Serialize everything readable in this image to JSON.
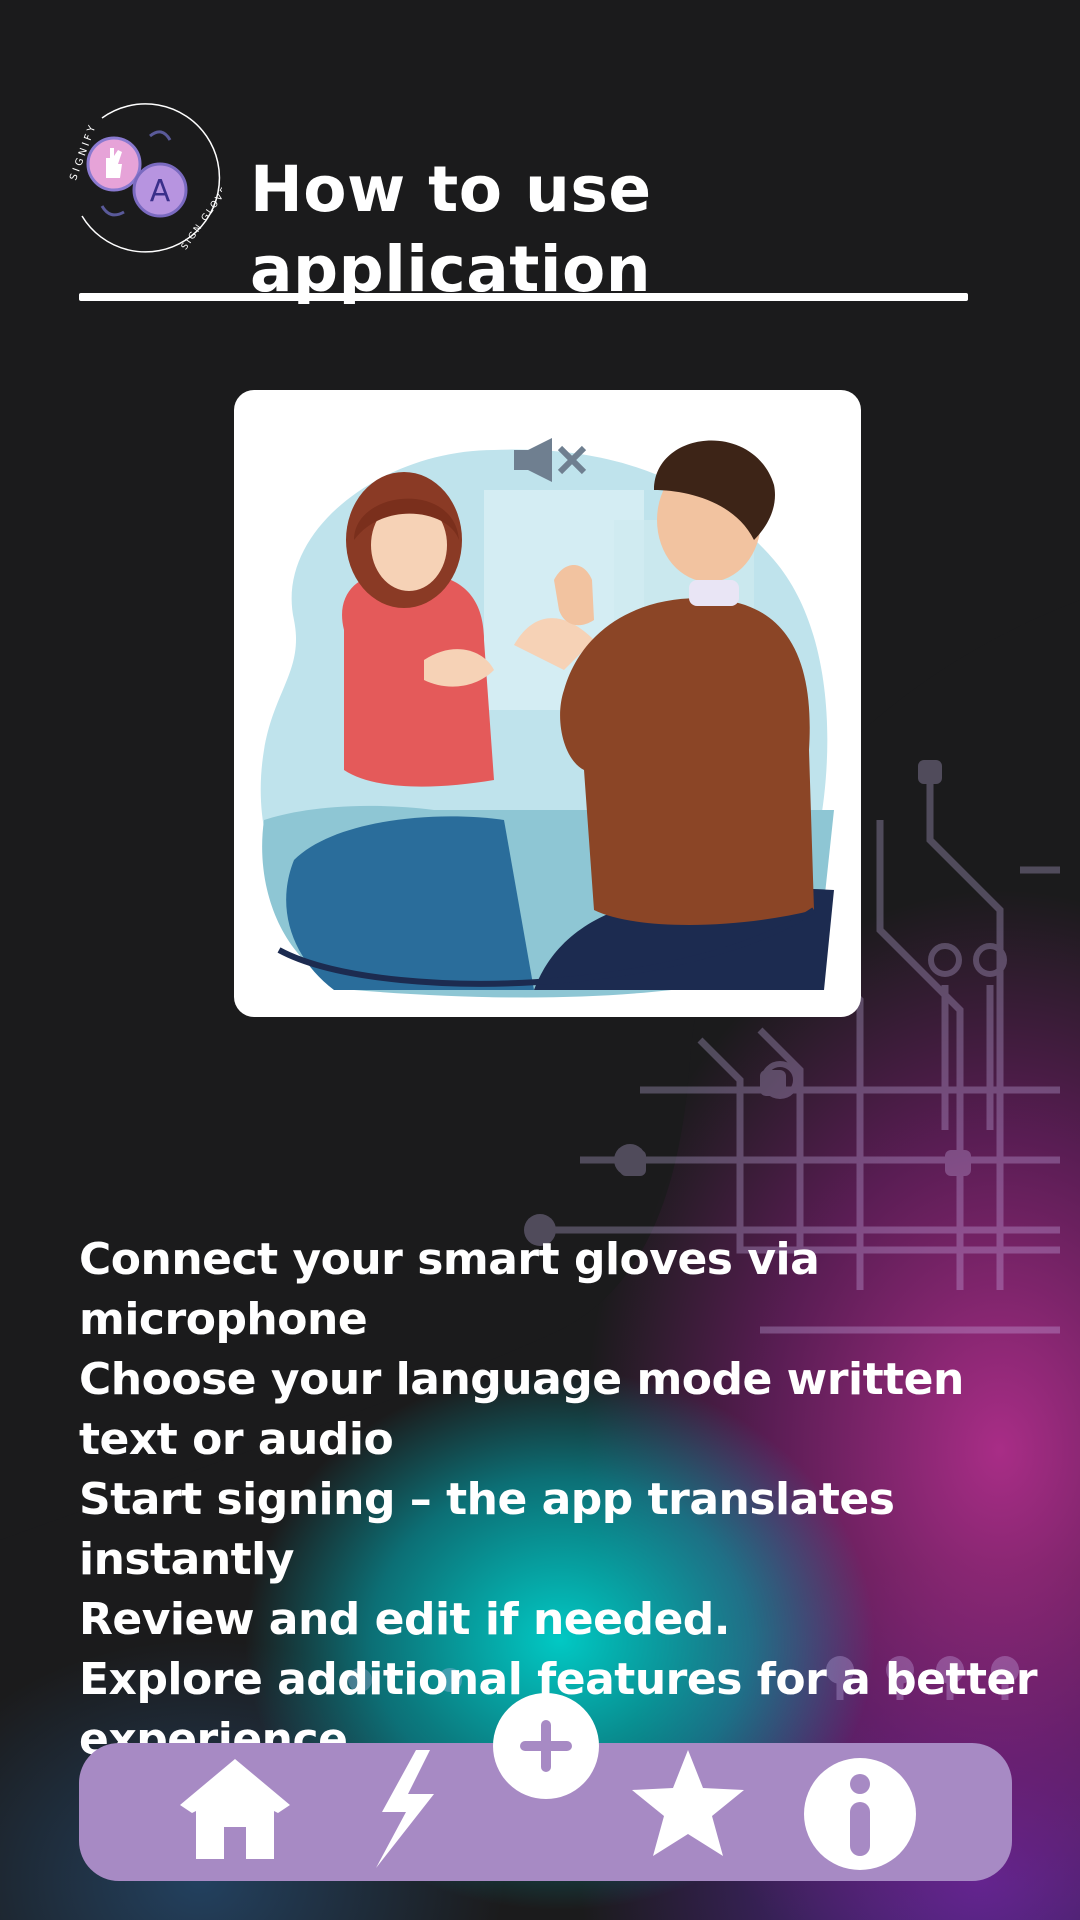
{
  "header": {
    "title": "How to use application",
    "logo": {
      "ring_text_top": "SIGNIFY",
      "ring_text_bottom": "SIGN GLOVE",
      "letter": "A"
    }
  },
  "illustration": {
    "description_icon": "mute-speaker-icon"
  },
  "instructions": [
    "Connect your smart gloves via microphone",
    "Choose your language mode written text or audio",
    "Start signing – the app translates instantly",
    "Review and edit if needed.",
    "Explore additional features for a better experience"
  ],
  "nav": {
    "items": [
      {
        "icon": "home-icon"
      },
      {
        "icon": "lightning-icon"
      },
      {
        "icon": "plus-icon"
      },
      {
        "icon": "star-icon"
      },
      {
        "icon": "info-icon"
      }
    ]
  },
  "colors": {
    "background": "#1b1b1c",
    "navbar": "#a78ac4",
    "accent_pink": "#e6a3d8",
    "accent_purple": "#b794e0"
  }
}
